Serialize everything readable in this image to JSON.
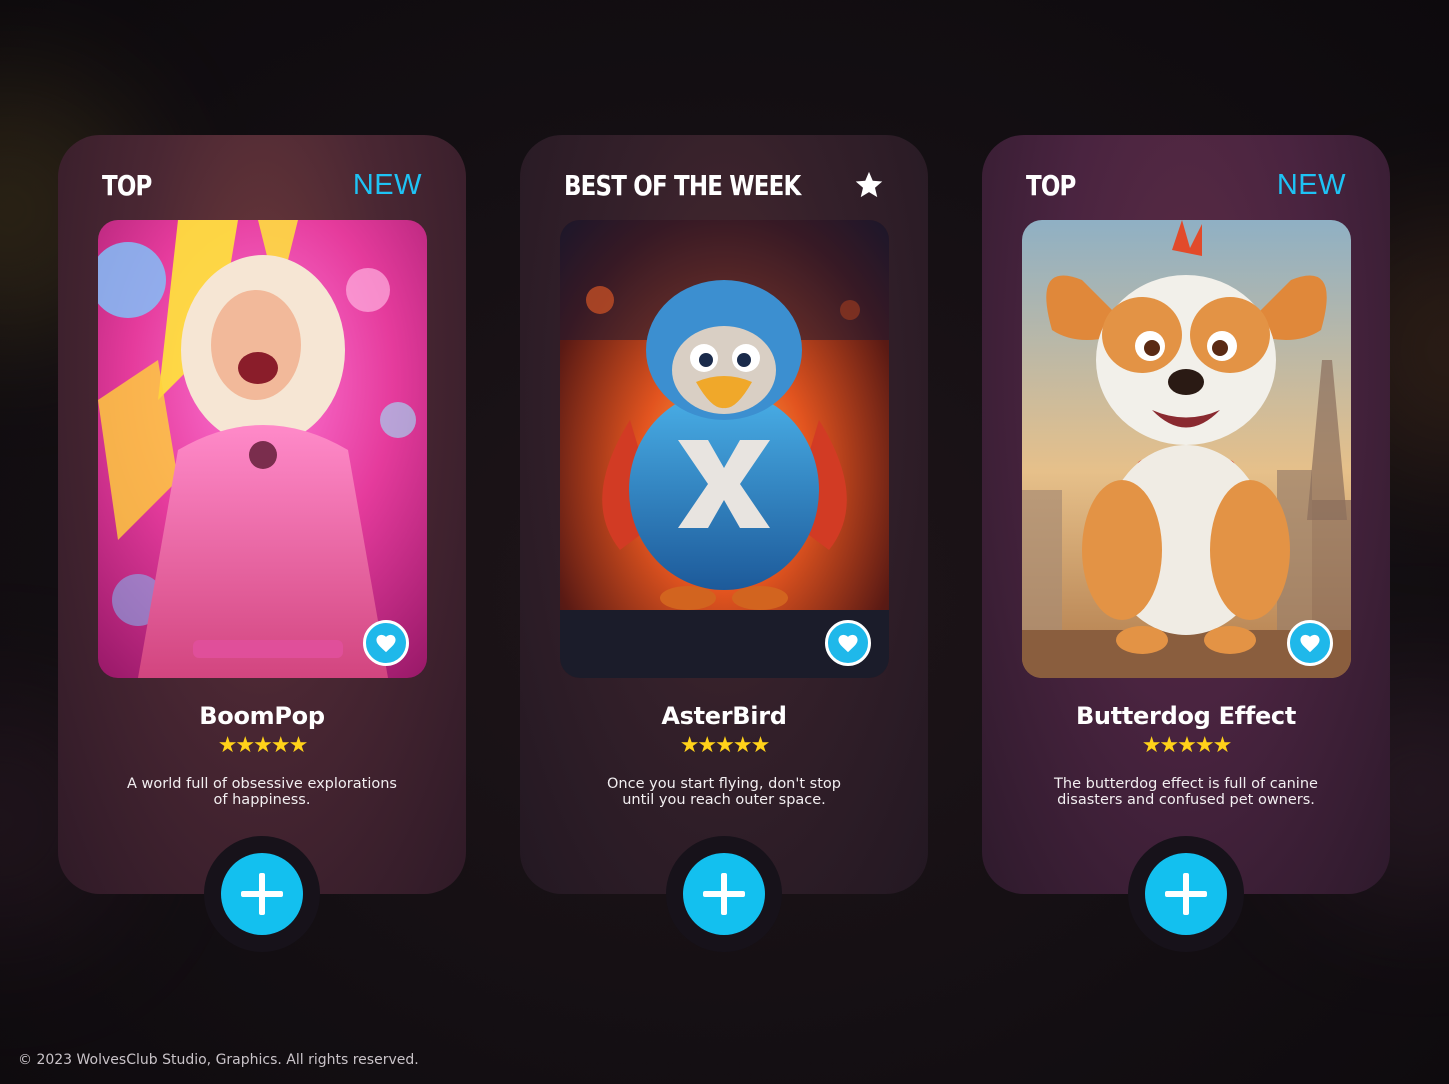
{
  "cards": [
    {
      "label_left": "TOP",
      "label_right": "NEW",
      "title": "BoomPop",
      "rating": "★★★★★",
      "description_line1": "A world full of obsessive explorations",
      "description_line2": "of happiness.",
      "accent": "#1ec3f5"
    },
    {
      "label_left": "BEST OF THE WEEK",
      "label_right_icon": "star-icon",
      "title": "AsterBird",
      "rating": "★★★★★",
      "description_line1": "Once you start flying, don't stop",
      "description_line2": "until you reach outer space.",
      "accent": "#1ec3f5"
    },
    {
      "label_left": "TOP",
      "label_right": "NEW",
      "title": "Butterdog Effect",
      "rating": "★★★★★",
      "description_line1": "The butterdog effect is full of canine",
      "description_line2": "disasters and confused pet owners.",
      "accent": "#1ec3f5"
    }
  ],
  "icons": {
    "favorite": "heart-icon",
    "add": "plus-icon",
    "featured": "star-icon"
  },
  "colors": {
    "accent_blue": "#13c0ef",
    "star_yellow": "#ffd21a",
    "background": "#140f13"
  },
  "footer": {
    "copyright": "© 2023 WolvesClub Studio, Graphics. All rights reserved."
  }
}
